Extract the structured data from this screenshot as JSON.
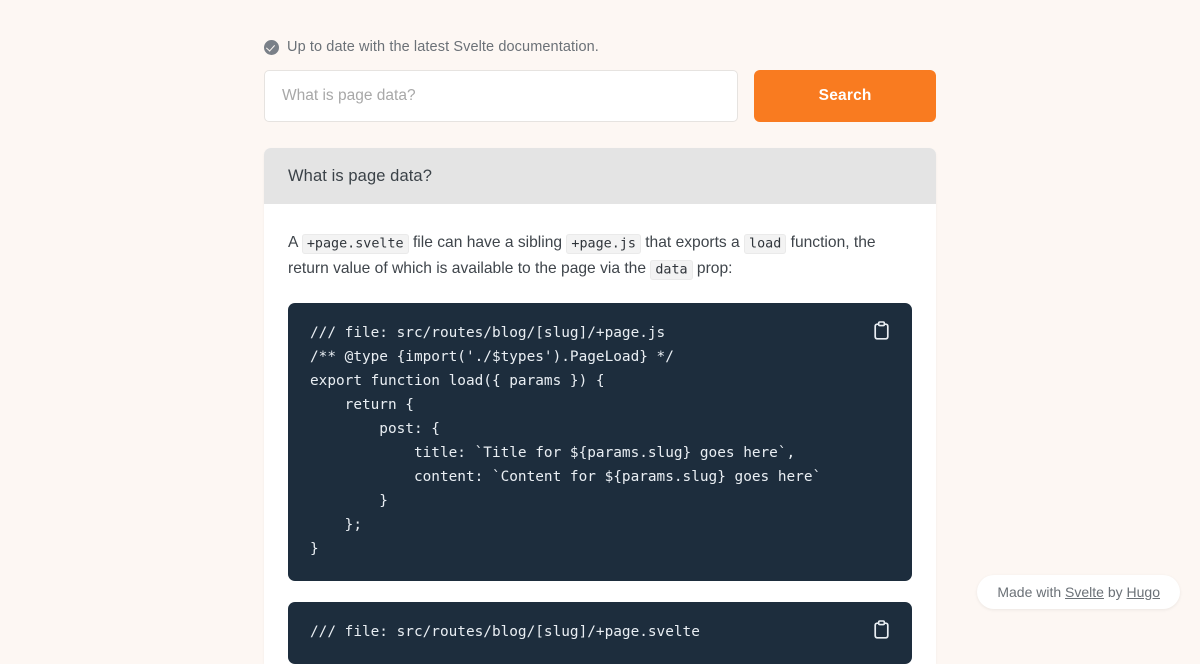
{
  "status": {
    "icon": "check-circle-icon",
    "text": "Up to date with the latest Svelte documentation."
  },
  "search": {
    "placeholder": "What is page data?",
    "value": "",
    "button_label": "Search"
  },
  "result": {
    "title": "What is page data?",
    "paragraph": {
      "part1": "A ",
      "code1": "+page.svelte",
      "part2": " file can have a sibling ",
      "code2": "+page.js",
      "part3": " that exports a ",
      "code3": "load",
      "part4": " function, the return value of which is available to the page via the ",
      "code4": "data",
      "part5": " prop:"
    },
    "code_blocks": [
      {
        "copy_label": "clipboard-icon",
        "content": "/// file: src/routes/blog/[slug]/+page.js\n/** @type {import('./$types').PageLoad} */\nexport function load({ params }) {\n    return {\n        post: {\n            title: `Title for ${params.slug} goes here`,\n            content: `Content for ${params.slug} goes here`\n        }\n    };\n}"
      },
      {
        "copy_label": "clipboard-icon",
        "content": "/// file: src/routes/blog/[slug]/+page.svelte"
      }
    ]
  },
  "footer": {
    "prefix": "Made with ",
    "link1": "Svelte",
    "middle": " by ",
    "link2": "Hugo"
  },
  "colors": {
    "page_background": "#fdf7f3",
    "accent_orange": "#f97b20",
    "code_background": "#1d2d3d",
    "header_gray": "#e4e4e4"
  }
}
